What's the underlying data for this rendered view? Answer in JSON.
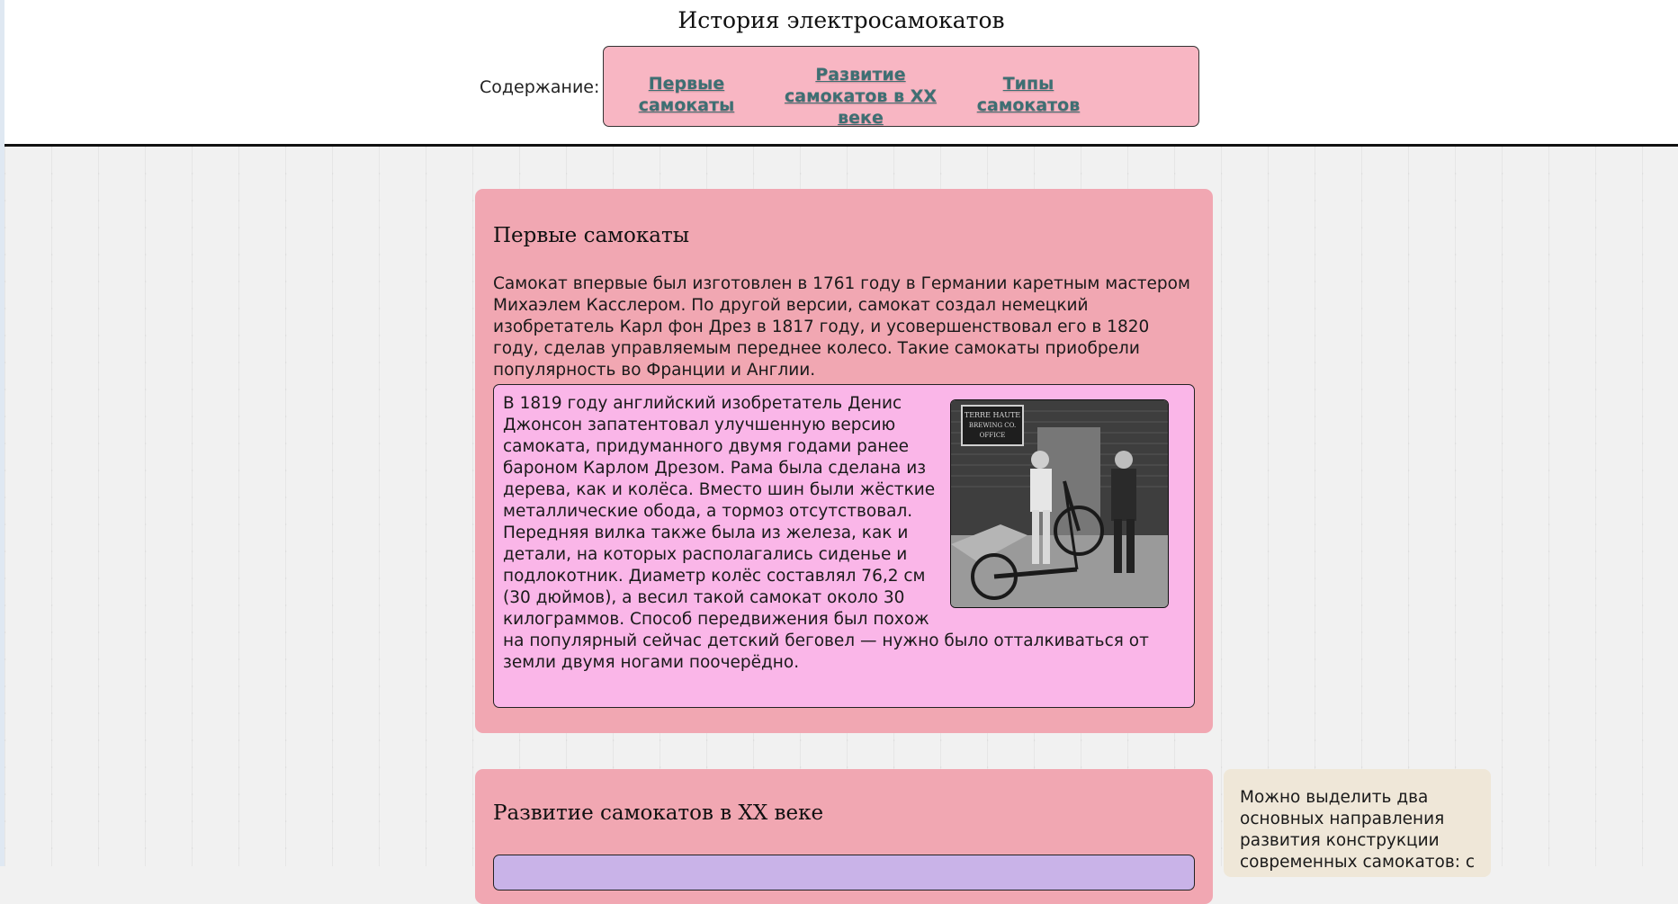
{
  "header": {
    "title": "История электросамокатов",
    "toc_label": "Содержание:",
    "toc_links": [
      {
        "label": "Первые самокаты"
      },
      {
        "label": "Развитие самокатов в XX веке"
      },
      {
        "label": "Типы самокатов"
      }
    ]
  },
  "sections": [
    {
      "title": "Первые самокаты",
      "intro": "Самокат впервые был изготовлен в 1761 году в Германии каретным мастером Михаэлем Касслером. По другой версии, самокат создал немецкий изобретатель Карл фон Дрез в 1817 году, и усовершенствовал его в 1820 году, сделав управляемым переднее колесо. Такие самокаты приобрели популярность во Франции и Англии.",
      "inner_text": "В 1819 году английский изобретатель Денис Джонсон запатентовал улучшенную версию самоката, придуманного двумя годами ранее бароном Карлом Дрезом. Рама была сделана из дерева, как и колёса. Вместо шин были жёсткие металлические обода, а тормоз отсутствовал. Передняя вилка также была из железа, как и детали, на которых располагались сиденье и подлокотник. Диаметр колёс составлял 76,2 см (30 дюймов), а весил такой самокат около 30 килограммов. Способ передвижения был похож на популярный сейчас детский беговел — нужно было отталкиваться от земли двумя ногами поочерёдно.",
      "photo_sign": "TERRE HAUTE BREWING CO. OFFICE"
    },
    {
      "title": "Развитие самокатов в XX веке"
    }
  ],
  "aside": {
    "text": "Можно выделить два основных направления развития конструкции современных самокатов: с"
  },
  "colors": {
    "section_bg": "#f1a7b2",
    "inner_bg": "#fab6e8",
    "toc_bg": "#f8b6c3",
    "link": "#3e6f73",
    "aside_bg": "#efe7d8",
    "purple_box": "#c9b3e8"
  }
}
